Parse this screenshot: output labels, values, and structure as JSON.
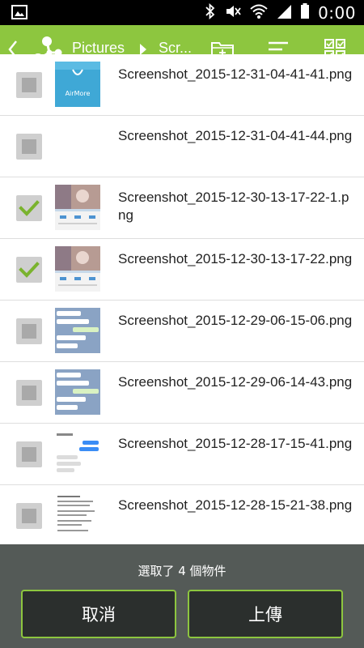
{
  "status_bar": {
    "time": "0:00"
  },
  "toolbar": {
    "breadcrumb_root": "Pictures",
    "breadcrumb_current": "Scr..."
  },
  "files": [
    {
      "name": "Screenshot_2015-12-31-04-41-41.png",
      "checked": false,
      "thumb": "blue-app",
      "thumb_text": "AirMore"
    },
    {
      "name": "Screenshot_2015-12-31-04-41-44.png",
      "checked": false,
      "thumb": "blank"
    },
    {
      "name": "Screenshot_2015-12-30-13-17-22-1.png",
      "checked": true,
      "thumb": "photo-profile"
    },
    {
      "name": "Screenshot_2015-12-30-13-17-22.png",
      "checked": true,
      "thumb": "photo-profile"
    },
    {
      "name": "Screenshot_2015-12-29-06-15-06.png",
      "checked": false,
      "thumb": "chat-blue"
    },
    {
      "name": "Screenshot_2015-12-29-06-14-43.png",
      "checked": false,
      "thumb": "chat-blue"
    },
    {
      "name": "Screenshot_2015-12-28-17-15-41.png",
      "checked": false,
      "thumb": "chat-white"
    },
    {
      "name": "Screenshot_2015-12-28-15-21-38.png",
      "checked": false,
      "thumb": "text-white"
    }
  ],
  "selection": {
    "count_text": "選取了 4 個物件",
    "cancel_label": "取消",
    "upload_label": "上傳"
  },
  "colors": {
    "accent": "#8dc63f",
    "bottom_bg": "#545a57",
    "button_bg": "#2b2f2d"
  }
}
